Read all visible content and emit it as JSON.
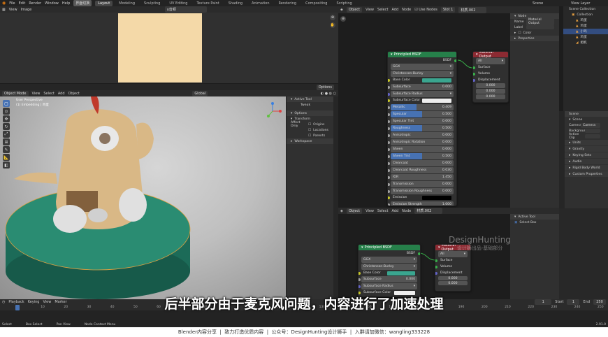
{
  "topmenu": {
    "menus": [
      "File",
      "Edit",
      "Render",
      "Window",
      "Help"
    ],
    "chinese_btn": "界面切换",
    "workspaces": [
      "Layout",
      "Modeling",
      "Sculpting",
      "UV Editing",
      "Texture Paint",
      "Shading",
      "Animation",
      "Rendering",
      "Compositing",
      "Scripting"
    ],
    "scene_label": "Scene",
    "viewlayer_label": "View Layer"
  },
  "image_editor": {
    "menus": [
      "View",
      "Image"
    ],
    "image_name": "u音频"
  },
  "viewport": {
    "mode": "Object Mode",
    "menus": [
      "View",
      "Select",
      "Add",
      "Object"
    ],
    "global": "Global",
    "options": "Options",
    "info1": "User Perspective",
    "info2": "(1) Embedding | 鸡蛋",
    "active_tool_title": "Active Tool",
    "tweak": "Tweak",
    "options_title": "Options",
    "transform": "Transform",
    "affect_only": "Affect Only",
    "origins": "Origins",
    "locations": "Locations",
    "parents": "Parents",
    "workspace": "Workspace"
  },
  "node_editor": {
    "object": "Object",
    "menus": [
      "View",
      "Select",
      "Add",
      "Node"
    ],
    "use_nodes": "Use Nodes",
    "slot": "Slot 1",
    "material": "材质.002",
    "sidebar": {
      "node_title": "Node",
      "name_label": "Name",
      "name_value": "Material Output",
      "label_label": "Label",
      "color": "Color",
      "properties": "Properties"
    }
  },
  "bsdf": {
    "title": "Principled BSDF",
    "output": "BSDF",
    "dist": "GGX",
    "sss": "Christensen-Burley",
    "rows": [
      {
        "label": "Base Color",
        "kind": "color",
        "color": "#3aa58f"
      },
      {
        "label": "Subsurface",
        "value": "0.000"
      },
      {
        "label": "Subsurface Radius",
        "kind": "drop"
      },
      {
        "label": "Subsurface Color",
        "kind": "color",
        "color": "#eeeeee"
      },
      {
        "label": "Metallic",
        "value": "0.409",
        "fill": 0.409
      },
      {
        "label": "Specular",
        "value": "0.500",
        "fill": 0.5
      },
      {
        "label": "Specular Tint",
        "value": "0.000"
      },
      {
        "label": "Roughness",
        "value": "0.500",
        "fill": 0.5
      },
      {
        "label": "Anisotropic",
        "value": "0.000"
      },
      {
        "label": "Anisotropic Rotation",
        "value": "0.000"
      },
      {
        "label": "Sheen",
        "value": "0.000"
      },
      {
        "label": "Sheen Tint",
        "value": "0.500",
        "fill": 0.5
      },
      {
        "label": "Clearcoat",
        "value": "0.000"
      },
      {
        "label": "Clearcoat Roughness",
        "value": "0.030"
      },
      {
        "label": "IOR",
        "value": "1.450"
      },
      {
        "label": "Transmission",
        "value": "0.000"
      },
      {
        "label": "Transmission Roughness",
        "value": "0.000"
      },
      {
        "label": "Emission",
        "kind": "color",
        "color": "#000000"
      },
      {
        "label": "Emission Strength",
        "value": "1.000"
      },
      {
        "label": "Alpha",
        "value": "1.000",
        "fill": 1
      }
    ]
  },
  "matout": {
    "title": "Material Output",
    "target": "All",
    "surface": "Surface",
    "volume": "Volume",
    "displacement": "Displacement",
    "v1": "0.000",
    "v2": "0.000",
    "v3": "0.000"
  },
  "outliner": {
    "title": "Scene Collection",
    "items": [
      "Collection",
      "鸡蛋",
      "鸡蛋",
      "小鸡",
      "鸡蛋",
      "相机"
    ]
  },
  "props": {
    "scene_label": "Scene",
    "scene_section": "Scene",
    "camera_label": "Camera",
    "camera_value": "Camera",
    "bg_label": "Background...",
    "clip_label": "Active Clip",
    "sections": [
      "Units",
      "Gravity",
      "Keying Sets",
      "Audio",
      "Rigid Body World",
      "Custom Properties"
    ]
  },
  "lower_node": {
    "material": "材质.002",
    "bsdf_title": "Principled BSDF",
    "bsdf_out": "BSDF",
    "dist": "GGX",
    "sss": "Christensen-Burley",
    "rows": [
      "Base Color",
      "Subsurface",
      "Subsurface Radius",
      "Subsurface Color"
    ],
    "subsurface_value": "0.000",
    "out_title": "Material Output",
    "target": "All",
    "surface": "Surface",
    "volume": "Volume",
    "displacement": "Displacement",
    "v": "0.000",
    "active_tool": "Active Tool",
    "select_box": "Select Box"
  },
  "watermark": {
    "line1": "DesignHunting",
    "line2": "设计狮出品-基础部分"
  },
  "subtitle": "后半部分由于麦克风问题，内容进行了加速处理",
  "timeline": {
    "menus": [
      "Playback",
      "Keying",
      "View",
      "Marker"
    ],
    "frame": "1",
    "start_label": "Start",
    "start": "1",
    "end_label": "End",
    "end": "250",
    "ticks": [
      "0",
      "10",
      "20",
      "30",
      "40",
      "50",
      "60",
      "70",
      "80",
      "90",
      "100",
      "110",
      "120",
      "130",
      "140",
      "150",
      "160",
      "170",
      "180",
      "190",
      "200",
      "210",
      "220",
      "230",
      "240",
      "250"
    ]
  },
  "statusbar": {
    "select": "Select",
    "box": "Box Select",
    "pan": "Pan View",
    "context": "Node Context Menu",
    "version": "2.91.0"
  },
  "footer": "Blender内容分享  |  致力打造优质内容  |  公众号：DesignHunting设计狮手  |  入群请加微信：wangling333228",
  "colors": {
    "accent": "#4772b3",
    "bsdf_header": "#26804a",
    "out_header": "#8c2a32",
    "base": "#3aa58f",
    "wire": "#bdbd3a",
    "wire_green": "#38b04a"
  }
}
